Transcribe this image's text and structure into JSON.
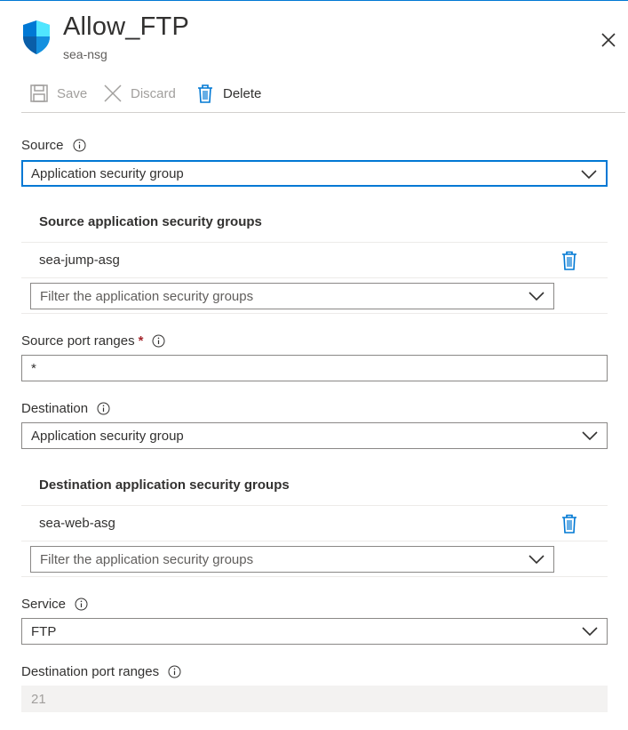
{
  "header": {
    "title": "Allow_FTP",
    "subtitle": "sea-nsg"
  },
  "toolbar": {
    "save_label": "Save",
    "discard_label": "Discard",
    "delete_label": "Delete"
  },
  "source": {
    "label": "Source",
    "value": "Application security group",
    "asg_section_title": "Source application security groups",
    "asg_items": [
      "sea-jump-asg"
    ],
    "filter_placeholder": "Filter the application security groups"
  },
  "source_port_ranges": {
    "label": "Source port ranges",
    "required_mark": "*",
    "value": "*"
  },
  "destination": {
    "label": "Destination",
    "value": "Application security group",
    "asg_section_title": "Destination application security groups",
    "asg_items": [
      "sea-web-asg"
    ],
    "filter_placeholder": "Filter the application security groups"
  },
  "service": {
    "label": "Service",
    "value": "FTP"
  },
  "destination_port_ranges": {
    "label": "Destination port ranges",
    "value": "21"
  },
  "colors": {
    "accent": "#0078d4",
    "required": "#a4262c"
  }
}
